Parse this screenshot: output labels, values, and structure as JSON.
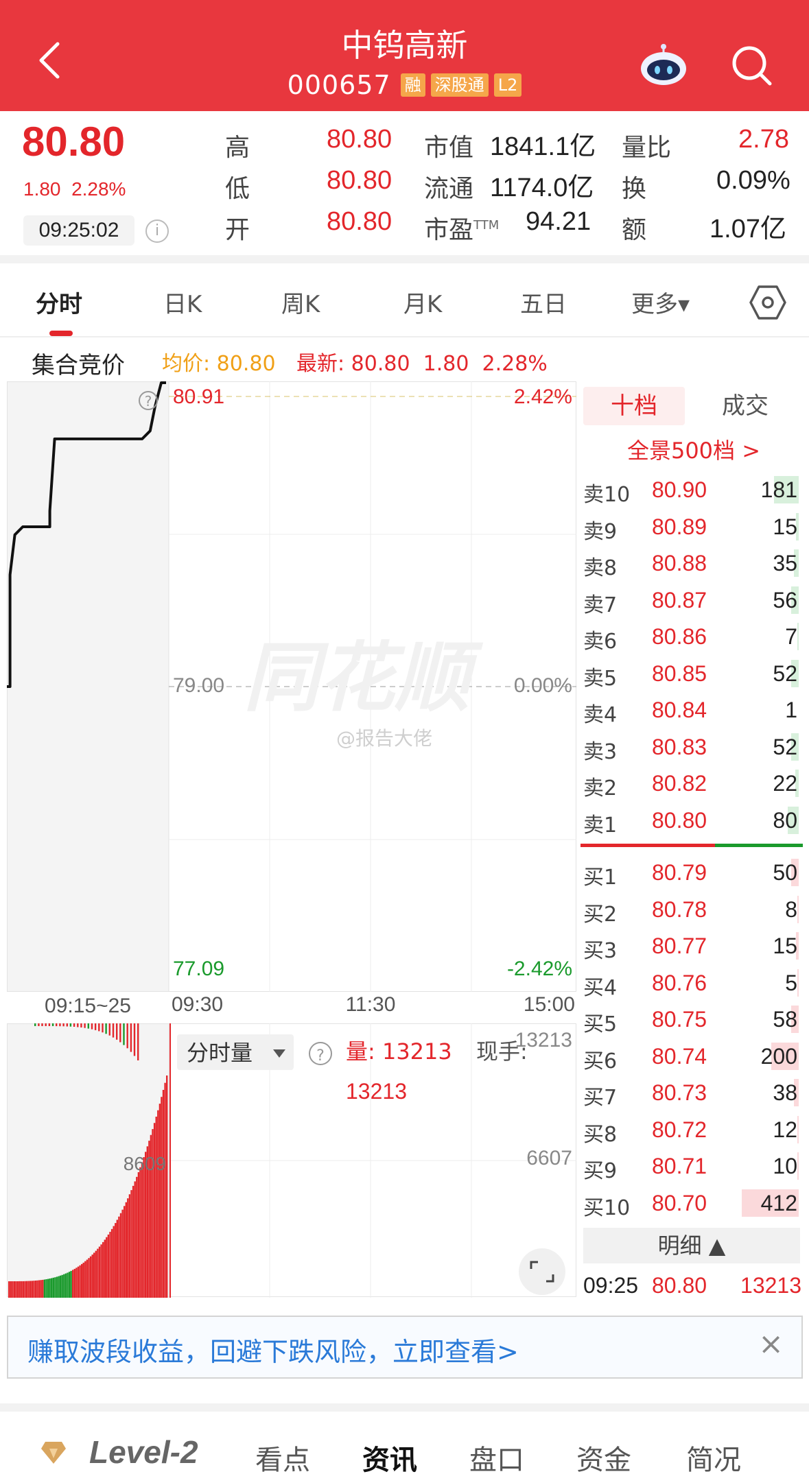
{
  "header": {
    "stock_name": "中钨高新",
    "stock_code": "000657",
    "tags": [
      "融",
      "深股通",
      "L2"
    ],
    "icons": [
      "back-icon",
      "robot-assistant-icon",
      "search-icon"
    ],
    "bg_color": "#e8373e"
  },
  "quote": {
    "price": "80.80",
    "change": "1.80",
    "change_pct": "2.28%",
    "time": "09:25:02",
    "stats": [
      {
        "label": "高",
        "value": "80.80",
        "label2": "市值",
        "value2": "1841.1亿",
        "label3": "量比",
        "value3": "2.78"
      },
      {
        "label": "低",
        "value": "80.80",
        "label2": "流通",
        "value2": "1174.0亿",
        "label3": "换",
        "value3": "0.09%"
      },
      {
        "label": "开",
        "value": "80.80",
        "label2": "市盈",
        "label2_sup": "TTM",
        "value2": "94.21",
        "label3": "额",
        "value3": "1.07亿"
      }
    ]
  },
  "tabs": [
    "分时",
    "日K",
    "周K",
    "月K",
    "五日",
    "更多▾"
  ],
  "chart_header": {
    "auction": "集合竞价",
    "avg": "均价: 80.80",
    "latest": "最新: 80.80",
    "latest_chg": "1.80",
    "latest_pct": "2.28%"
  },
  "chart_data": {
    "type": "line",
    "price_axis": {
      "max": "80.91",
      "mid": "79.00",
      "min": "77.09",
      "pct_max": "2.42%",
      "pct_mid": "0.00%",
      "pct_min": "-2.42%"
    },
    "time_axis": [
      "09:15~25",
      "09:30",
      "11:30",
      "15:00"
    ],
    "auction_price_path": [
      {
        "x": 0.0,
        "y": 79.0
      },
      {
        "x": 0.02,
        "y": 79.0
      },
      {
        "x": 0.02,
        "y": 79.7
      },
      {
        "x": 0.05,
        "y": 79.95
      },
      {
        "x": 0.1,
        "y": 80.0
      },
      {
        "x": 0.27,
        "y": 80.0
      },
      {
        "x": 0.27,
        "y": 80.1
      },
      {
        "x": 0.3,
        "y": 80.55
      },
      {
        "x": 0.85,
        "y": 80.55
      },
      {
        "x": 0.9,
        "y": 80.6
      },
      {
        "x": 0.93,
        "y": 80.75
      },
      {
        "x": 0.97,
        "y": 80.95
      },
      {
        "x": 1.0,
        "y": 80.95
      }
    ],
    "volume_axis": {
      "max": "13213",
      "mid": "6607",
      "auction_mid": "8609"
    },
    "volume_label": "分时量",
    "volume_value_label": "量: 13213",
    "volume_value_line2": "13213",
    "current_hand_label": "现手:",
    "watermark": "同花顺",
    "weibo_watermark": "@报告大佬"
  },
  "orderbook": {
    "tabs": [
      "十档",
      "成交"
    ],
    "panorama": "全景500档 >",
    "asks": [
      {
        "label": "卖10",
        "price": "80.90",
        "vol": "181",
        "fill": 0.2
      },
      {
        "label": "卖9",
        "price": "80.89",
        "vol": "15",
        "fill": 0.02
      },
      {
        "label": "卖8",
        "price": "80.88",
        "vol": "35",
        "fill": 0.04
      },
      {
        "label": "卖7",
        "price": "80.87",
        "vol": "56",
        "fill": 0.06
      },
      {
        "label": "卖6",
        "price": "80.86",
        "vol": "7",
        "fill": 0.01
      },
      {
        "label": "卖5",
        "price": "80.85",
        "vol": "52",
        "fill": 0.06
      },
      {
        "label": "卖4",
        "price": "80.84",
        "vol": "1",
        "fill": 0.0
      },
      {
        "label": "卖3",
        "price": "80.83",
        "vol": "52",
        "fill": 0.06
      },
      {
        "label": "卖2",
        "price": "80.82",
        "vol": "22",
        "fill": 0.03
      },
      {
        "label": "卖1",
        "price": "80.80",
        "vol": "80",
        "fill": 0.09
      }
    ],
    "bids": [
      {
        "label": "买1",
        "price": "80.79",
        "vol": "50",
        "fill": 0.06
      },
      {
        "label": "买2",
        "price": "80.78",
        "vol": "8",
        "fill": 0.01
      },
      {
        "label": "买3",
        "price": "80.77",
        "vol": "15",
        "fill": 0.02
      },
      {
        "label": "买4",
        "price": "80.76",
        "vol": "5",
        "fill": 0.01
      },
      {
        "label": "买5",
        "price": "80.75",
        "vol": "58",
        "fill": 0.06
      },
      {
        "label": "买6",
        "price": "80.74",
        "vol": "200",
        "fill": 0.22
      },
      {
        "label": "买7",
        "price": "80.73",
        "vol": "38",
        "fill": 0.04
      },
      {
        "label": "买8",
        "price": "80.72",
        "vol": "12",
        "fill": 0.01
      },
      {
        "label": "买9",
        "price": "80.71",
        "vol": "10",
        "fill": 0.01
      },
      {
        "label": "买10",
        "price": "80.70",
        "vol": "412",
        "fill": 0.46
      }
    ],
    "detail_label": "明细 ▲",
    "detail_row": {
      "time": "09:25",
      "price": "80.80",
      "vol": "13213"
    }
  },
  "banner": {
    "text": "赚取波段收益，回避下跌风险，立即查看>",
    "close": "×"
  },
  "bottom_tabs": [
    "Level-2",
    "看点",
    "资讯",
    "盘口",
    "资金",
    "简况"
  ],
  "colors": {
    "up": "#e3262b",
    "down": "#1a9a2c",
    "avg": "#f0a017",
    "link": "#2a7ad8"
  }
}
